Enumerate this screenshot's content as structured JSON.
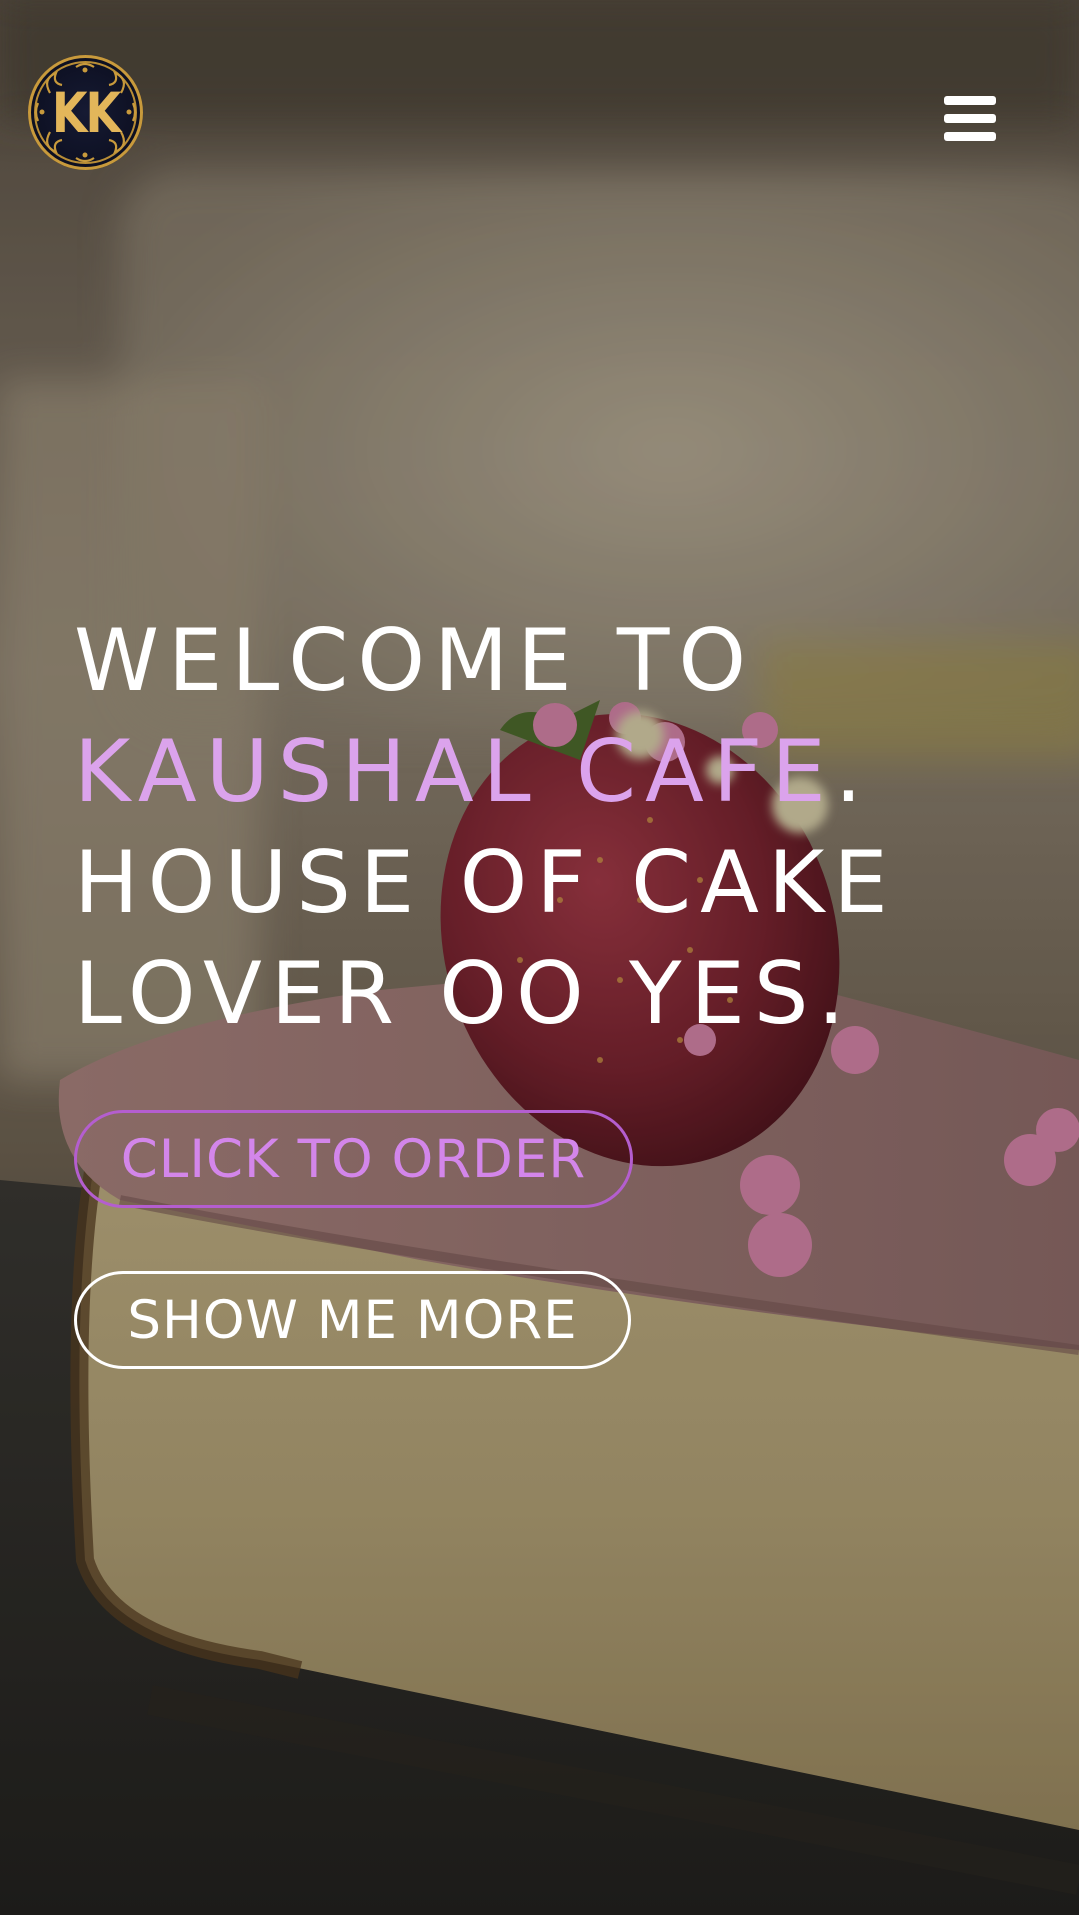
{
  "brand": {
    "logo_text": "KK",
    "accent_color": "#dba3ec",
    "logo_gold": "#e3b65a",
    "logo_navy": "#0d1022"
  },
  "nav": {
    "menu_icon": "hamburger-menu-icon"
  },
  "hero": {
    "headline_line1": "WELCOME TO",
    "headline_brand": "KAUSHAL CAFE",
    "headline_brand_period": ".",
    "headline_line3": "HOUSE OF CAKE",
    "headline_line4": "LOVER OO YES.",
    "background_image": "strawberry-cheesecake-slice"
  },
  "buttons": {
    "order_label": "CLICK TO ORDER",
    "more_label": "SHOW ME MORE",
    "order_color": "#b45ecf"
  }
}
